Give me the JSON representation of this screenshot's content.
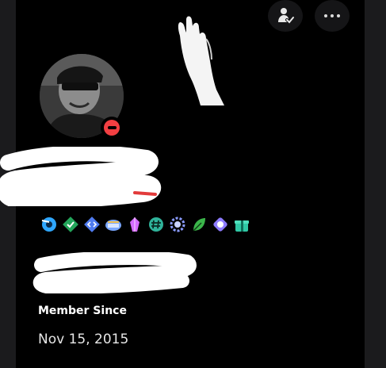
{
  "header": {
    "friend_button_icon": "friend-check-icon",
    "more_button_icon": "more-dots-icon"
  },
  "profile": {
    "status": "do-not-disturb",
    "status_color": "#f23f42"
  },
  "badges": [
    {
      "icon": "hypesquad-badge-icon",
      "color": "#2fa7ff"
    },
    {
      "icon": "active-developer-badge-icon",
      "color": "#23a55a"
    },
    {
      "icon": "developer-badge-icon",
      "color": "#4f7bf0"
    },
    {
      "icon": "quest-badge-icon",
      "color": "#7aa7ff"
    },
    {
      "icon": "nitro-gem-badge-icon",
      "color": "#d46bff"
    },
    {
      "icon": "hashtag-badge-icon",
      "color": "#2fb39a"
    },
    {
      "icon": "laurel-badge-icon",
      "color": "#8a9bff"
    },
    {
      "icon": "leaf-badge-icon",
      "color": "#3bb54a"
    },
    {
      "icon": "orb-badge-icon",
      "color": "#8d7bff"
    },
    {
      "icon": "gift-badge-icon",
      "color": "#30c8a5"
    }
  ],
  "member_since": {
    "label": "Member Since",
    "date": "Nov 15, 2015"
  }
}
